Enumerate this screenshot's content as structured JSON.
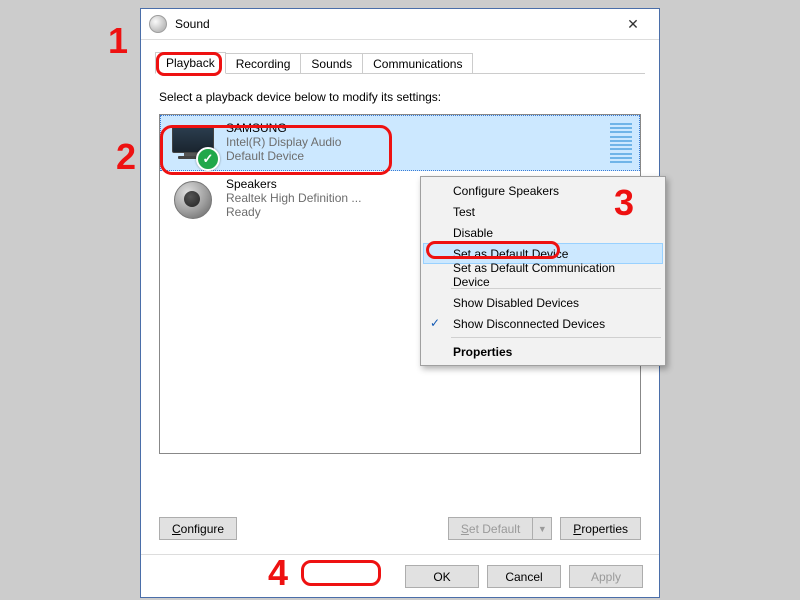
{
  "window": {
    "title": "Sound"
  },
  "tabs": [
    "Playback",
    "Recording",
    "Sounds",
    "Communications"
  ],
  "instruction": "Select a playback device below to modify its settings:",
  "devices": [
    {
      "name": "SAMSUNG",
      "sub1": "Intel(R) Display Audio",
      "sub2": "Default Device",
      "kind": "tv",
      "selected": true,
      "default": true
    },
    {
      "name": "Speakers",
      "sub1": "Realtek High Definition ...",
      "sub2": "Ready",
      "kind": "spk",
      "selected": false,
      "default": false
    }
  ],
  "lowerButtons": {
    "configure": "Configure",
    "setDefault": "Set Default",
    "properties": "Properties"
  },
  "bottomButtons": {
    "ok": "OK",
    "cancel": "Cancel",
    "apply": "Apply"
  },
  "contextMenu": {
    "items": [
      {
        "label": "Configure Speakers"
      },
      {
        "label": "Test"
      },
      {
        "label": "Disable"
      },
      {
        "label": "Set as Default Device",
        "highlighted": true
      },
      {
        "label": "Set as Default Communication Device"
      },
      {
        "sep": true
      },
      {
        "label": "Show Disabled Devices"
      },
      {
        "label": "Show Disconnected Devices",
        "checked": true
      },
      {
        "sep": true
      },
      {
        "label": "Properties",
        "bold": true
      }
    ]
  },
  "callouts": {
    "1": "1",
    "2": "2",
    "3": "3",
    "4": "4"
  }
}
